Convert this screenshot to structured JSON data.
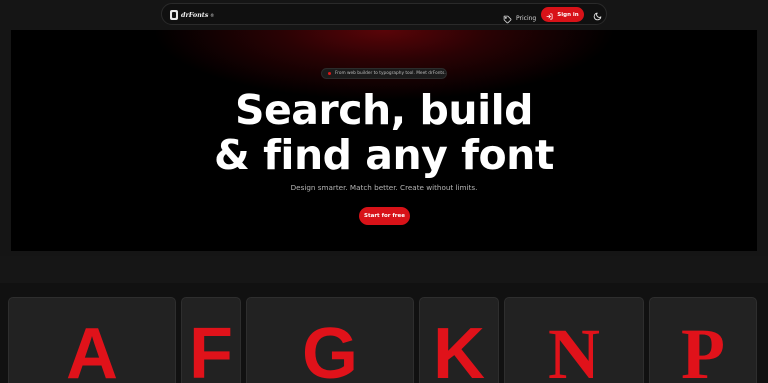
{
  "navbar": {
    "logo_text": "drFonts",
    "logo_reg": "®",
    "pricing_label": "Pricing",
    "signin_label": "Sign in",
    "icons": {
      "logo": "drfonts-logo-icon",
      "pricing": "tag-icon",
      "signin": "login-arrow-icon",
      "theme": "moon-icon"
    }
  },
  "hero": {
    "badge_text": "From web builder to typography tool. Meet drFonts.",
    "title_line1": "Search, build",
    "title_line2": "& find any font",
    "subtitle": "Design smarter. Match better. Create without limits.",
    "cta_label": "Start for free"
  },
  "glyph_cards": [
    {
      "glyph": "A"
    },
    {
      "glyph": "F"
    },
    {
      "glyph": "G"
    },
    {
      "glyph": "K"
    },
    {
      "glyph": "N"
    },
    {
      "glyph": "P"
    }
  ],
  "colors": {
    "accent": "#d81218",
    "glyph": "#e0121a",
    "background": "#151515",
    "hero_glow": "#5a0408"
  }
}
